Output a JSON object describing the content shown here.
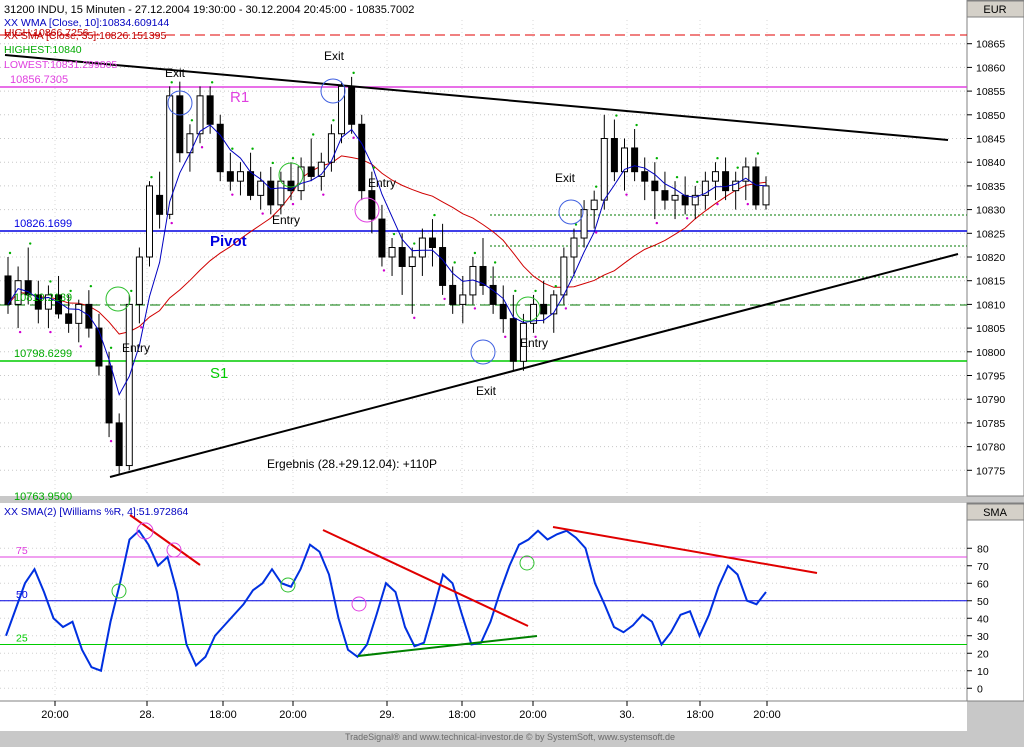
{
  "window": {
    "header": "31200  INDU, 15 Minuten - 27.12.2004 19:30:00 - 30.12.2004 20:45:00 - 10835.7002",
    "currency": "EUR",
    "lower_axis_label": "SMA",
    "footer": "TradeSignal® and www.technical-investor.de © by SystemSoft, www.systemsoft.de"
  },
  "legend": {
    "wma": "XX WMA [Close, 10]:10834.609144",
    "high": "HIGH:10866.7256",
    "sma": "XX SMA [Close, 35]:10826.151395",
    "highest": "HIGHEST:10840",
    "lowest": "LOWEST:10831.299805",
    "lower": "XX SMA(2) [Williams %R, 4]:51.972864"
  },
  "levels": {
    "r1": {
      "label": "R1",
      "value": 10856.7305,
      "value_label": "10856.7305",
      "color": "#e040e0"
    },
    "pivot": {
      "label": "Pivot",
      "value": 10826.1699,
      "value_label": "10826.1699",
      "color": "#0000e0"
    },
    "s1": {
      "label": "S1",
      "value": 10798.6299,
      "value_label": "10798.6299",
      "color": "#00cc00"
    },
    "green_dashed": {
      "value": 10810.2139,
      "value_label": "10810.2139"
    },
    "red_dashed": {
      "value": 10867.2
    },
    "bottom_label_partial": "10763.9500"
  },
  "annotations": {
    "labels": [
      {
        "text": "Exit",
        "role": "exit-label"
      },
      {
        "text": "Exit",
        "role": "exit-label"
      },
      {
        "text": "Entry",
        "role": "entry-label"
      },
      {
        "text": "Entry",
        "role": "entry-label"
      },
      {
        "text": "Entry",
        "role": "entry-label"
      },
      {
        "text": "Exit",
        "role": "exit-label"
      },
      {
        "text": "Exit",
        "role": "exit-label"
      },
      {
        "text": "Entry",
        "role": "entry-label"
      }
    ],
    "result": "Ergebnis (28.+29.12.04): +110P"
  },
  "chart_data": [
    {
      "type": "candlestick",
      "ylim": [
        10770,
        10870
      ],
      "y_ticks": [
        10775,
        10780,
        10785,
        10790,
        10795,
        10800,
        10805,
        10810,
        10815,
        10820,
        10825,
        10830,
        10835,
        10840,
        10845,
        10850,
        10855,
        10860,
        10865
      ],
      "x_ticks": [
        "20:00",
        "28.",
        "18:00",
        "20:00",
        "29.",
        "18:00",
        "20:00",
        "30.",
        "18:00",
        "20:00"
      ],
      "grid": true,
      "candles": [
        [
          10816,
          10820,
          10808,
          10810
        ],
        [
          10810,
          10818,
          10805,
          10815
        ],
        [
          10815,
          10822,
          10810,
          10812
        ],
        [
          10812,
          10815,
          10806,
          10809
        ],
        [
          10809,
          10814,
          10805,
          10812
        ],
        [
          10812,
          10816,
          10807,
          10808
        ],
        [
          10808,
          10812,
          10804,
          10806
        ],
        [
          10806,
          10811,
          10802,
          10810
        ],
        [
          10810,
          10813,
          10803,
          10805
        ],
        [
          10805,
          10808,
          10795,
          10797
        ],
        [
          10797,
          10800,
          10782,
          10785
        ],
        [
          10785,
          10787,
          10774,
          10776
        ],
        [
          10776,
          10812,
          10775,
          10810
        ],
        [
          10810,
          10822,
          10806,
          10820
        ],
        [
          10820,
          10836,
          10818,
          10835
        ],
        [
          10833,
          10838,
          10826,
          10829
        ],
        [
          10829,
          10856,
          10828,
          10854
        ],
        [
          10854,
          10857,
          10840,
          10842
        ],
        [
          10842,
          10848,
          10838,
          10846
        ],
        [
          10846,
          10856,
          10844,
          10854
        ],
        [
          10854,
          10856,
          10846,
          10848
        ],
        [
          10848,
          10850,
          10836,
          10838
        ],
        [
          10838,
          10842,
          10834,
          10836
        ],
        [
          10836,
          10840,
          10833,
          10838
        ],
        [
          10838,
          10842,
          10832,
          10833
        ],
        [
          10833,
          10838,
          10830,
          10836
        ],
        [
          10836,
          10839,
          10829,
          10831
        ],
        [
          10831,
          10838,
          10829,
          10836
        ],
        [
          10836,
          10840,
          10832,
          10834
        ],
        [
          10834,
          10841,
          10832,
          10839
        ],
        [
          10839,
          10845,
          10836,
          10837
        ],
        [
          10837,
          10842,
          10834,
          10840
        ],
        [
          10840,
          10848,
          10838,
          10846
        ],
        [
          10846,
          10857,
          10844,
          10856
        ],
        [
          10856,
          10858,
          10846,
          10848
        ],
        [
          10848,
          10850,
          10832,
          10834
        ],
        [
          10834,
          10838,
          10825,
          10828
        ],
        [
          10828,
          10831,
          10818,
          10820
        ],
        [
          10820,
          10824,
          10816,
          10822
        ],
        [
          10822,
          10825,
          10812,
          10818
        ],
        [
          10818,
          10822,
          10808,
          10820
        ],
        [
          10820,
          10826,
          10816,
          10824
        ],
        [
          10824,
          10828,
          10818,
          10822
        ],
        [
          10822,
          10827,
          10812,
          10814
        ],
        [
          10814,
          10818,
          10808,
          10810
        ],
        [
          10810,
          10816,
          10806,
          10812
        ],
        [
          10812,
          10820,
          10810,
          10818
        ],
        [
          10818,
          10824,
          10812,
          10814
        ],
        [
          10814,
          10818,
          10808,
          10810
        ],
        [
          10810,
          10814,
          10804,
          10807
        ],
        [
          10807,
          10812,
          10796,
          10798
        ],
        [
          10798,
          10808,
          10796,
          10806
        ],
        [
          10806,
          10812,
          10804,
          10810
        ],
        [
          10810,
          10815,
          10806,
          10808
        ],
        [
          10808,
          10813,
          10804,
          10812
        ],
        [
          10812,
          10822,
          10810,
          10820
        ],
        [
          10820,
          10826,
          10816,
          10824
        ],
        [
          10824,
          10832,
          10822,
          10830
        ],
        [
          10830,
          10834,
          10826,
          10832
        ],
        [
          10832,
          10850,
          10830,
          10845
        ],
        [
          10845,
          10849,
          10836,
          10838
        ],
        [
          10838,
          10845,
          10834,
          10843
        ],
        [
          10843,
          10847,
          10836,
          10838
        ],
        [
          10838,
          10841,
          10832,
          10836
        ],
        [
          10836,
          10840,
          10828,
          10834
        ],
        [
          10834,
          10838,
          10830,
          10832
        ],
        [
          10832,
          10836,
          10828,
          10833
        ],
        [
          10833,
          10837,
          10829,
          10831
        ],
        [
          10831,
          10835,
          10828,
          10833
        ],
        [
          10833,
          10838,
          10830,
          10836
        ],
        [
          10836,
          10840,
          10832,
          10838
        ],
        [
          10838,
          10841,
          10832,
          10834
        ],
        [
          10834,
          10838,
          10830,
          10836
        ],
        [
          10836,
          10841,
          10832,
          10839
        ],
        [
          10839,
          10841,
          10830,
          10831
        ],
        [
          10831,
          10837,
          10830,
          10835
        ]
      ]
    },
    {
      "type": "line",
      "ylim": [
        -5,
        95
      ],
      "y_ticks": [
        0,
        10,
        20,
        30,
        40,
        50,
        60,
        70,
        80
      ],
      "levels": [
        {
          "label": "75",
          "value": 75,
          "color": "#e040e0"
        },
        {
          "label": "50",
          "value": 50,
          "color": "#0000e0"
        },
        {
          "label": "25",
          "value": 25,
          "color": "#00cc00"
        }
      ],
      "values": [
        30,
        45,
        60,
        68,
        55,
        40,
        35,
        38,
        22,
        12,
        10,
        38,
        60,
        85,
        90,
        82,
        70,
        75,
        55,
        25,
        13,
        18,
        30,
        36,
        42,
        48,
        56,
        60,
        68,
        60,
        58,
        68,
        82,
        78,
        65,
        40,
        22,
        18,
        25,
        42,
        60,
        55,
        35,
        24,
        26,
        45,
        65,
        60,
        42,
        25,
        26,
        38,
        55,
        70,
        82,
        85,
        90,
        85,
        88,
        90,
        86,
        80,
        60,
        48,
        35,
        32,
        36,
        42,
        38,
        25,
        32,
        42,
        44,
        30,
        42,
        58,
        70,
        65,
        50,
        48,
        55
      ]
    }
  ]
}
